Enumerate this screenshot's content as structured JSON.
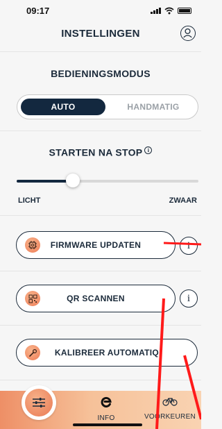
{
  "status_bar": {
    "time": "09:17"
  },
  "header": {
    "title": "INSTELLINGEN",
    "profile_icon": "person-circle-icon"
  },
  "operating_mode": {
    "title": "BEDIENINGSMODUS",
    "options": [
      "AUTO",
      "HANDMATIG"
    ],
    "selected": "AUTO"
  },
  "start_after_stop": {
    "title": "STARTEN NA STOP",
    "info_icon": "info-icon",
    "slider_value_fraction": 0.31,
    "min_label": "LICHT",
    "max_label": "ZWAAR"
  },
  "actions": {
    "firmware": {
      "label": "FIRMWARE UPDATEN",
      "icon": "chip-gear-icon"
    },
    "qr": {
      "label": "QR SCANNEN",
      "icon": "qr-code-icon"
    },
    "calibrate": {
      "label": "KALIBREER AUTOMATIQ",
      "icon": "wrench-icon"
    }
  },
  "tabbar": {
    "settings_icon": "sliders-icon",
    "info": {
      "label": "INFO",
      "icon": "e-logo-icon"
    },
    "preferences": {
      "label": "VOORKEUREN",
      "icon": "bicycle-icon"
    }
  },
  "colors": {
    "primary": "#13283f",
    "accent": "#ee7c56",
    "background": "#f6f6f6",
    "annotation": "#ff1a1a"
  }
}
